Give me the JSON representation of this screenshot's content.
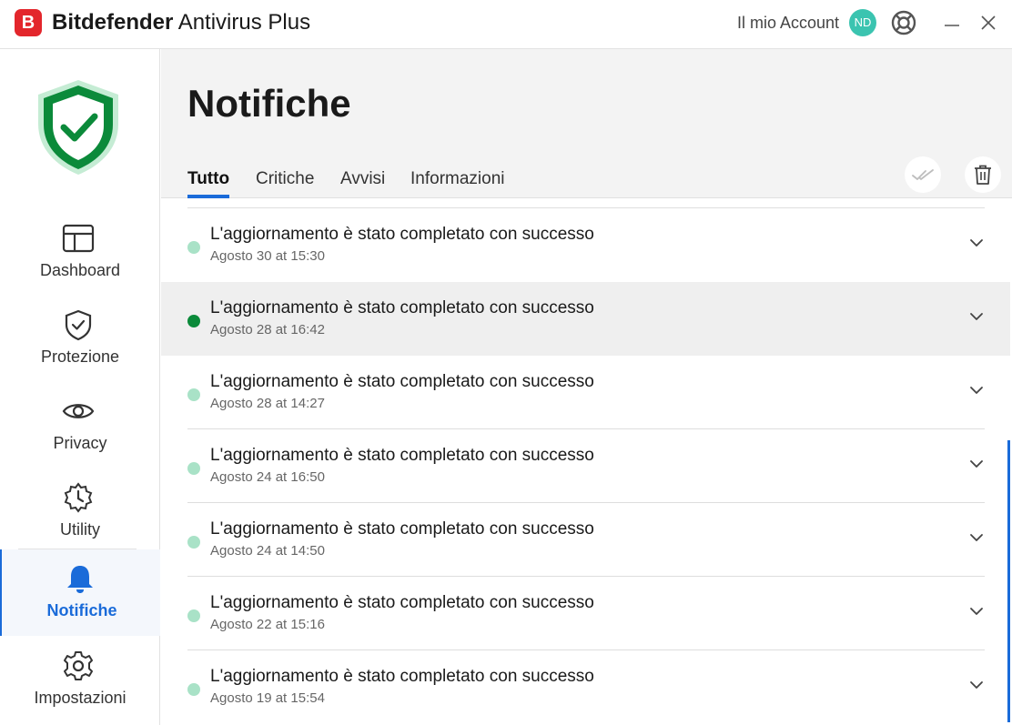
{
  "titlebar": {
    "logo_letter": "B",
    "brand": "Bitdefender",
    "product": "Antivirus Plus",
    "account_label": "Il mio Account",
    "avatar_initials": "ND",
    "avatar_color": "#3bc4b0",
    "accent_red": "#e3262c"
  },
  "sidebar": {
    "status_icon": "shield-check-icon",
    "status_color": "#0b8a3a",
    "items": [
      {
        "label": "Dashboard",
        "icon": "dashboard-icon"
      },
      {
        "label": "Protezione",
        "icon": "shield-icon"
      },
      {
        "label": "Privacy",
        "icon": "eye-icon"
      },
      {
        "label": "Utility",
        "icon": "gear-clock-icon"
      },
      {
        "label": "Notifiche",
        "icon": "bell-icon",
        "active": true
      },
      {
        "label": "Impostazioni",
        "icon": "settings-gear-icon"
      }
    ],
    "accent_blue": "#1a6bd9"
  },
  "main": {
    "title": "Notifiche",
    "tabs": [
      {
        "label": "Tutto",
        "active": true
      },
      {
        "label": "Critiche"
      },
      {
        "label": "Avvisi"
      },
      {
        "label": "Informazioni"
      }
    ],
    "actions": [
      {
        "icon": "double-check-icon"
      },
      {
        "icon": "trash-icon"
      }
    ],
    "notifications": [
      {
        "title": "L'aggiornamento è stato completato con successo",
        "time": "Agosto 30 at 15:30",
        "unread": false
      },
      {
        "title": "L'aggiornamento è stato completato con successo",
        "time": "Agosto 28 at 16:42",
        "unread": true
      },
      {
        "title": "L'aggiornamento è stato completato con successo",
        "time": "Agosto 28 at 14:27",
        "unread": false
      },
      {
        "title": "L'aggiornamento è stato completato con successo",
        "time": "Agosto 24 at 16:50",
        "unread": false
      },
      {
        "title": "L'aggiornamento è stato completato con successo",
        "time": "Agosto 24 at 14:50",
        "unread": false
      },
      {
        "title": "L'aggiornamento è stato completato con successo",
        "time": "Agosto 22 at 15:16",
        "unread": false
      },
      {
        "title": "L'aggiornamento è stato completato con successo",
        "time": "Agosto 19 at 15:54",
        "unread": false
      }
    ]
  }
}
